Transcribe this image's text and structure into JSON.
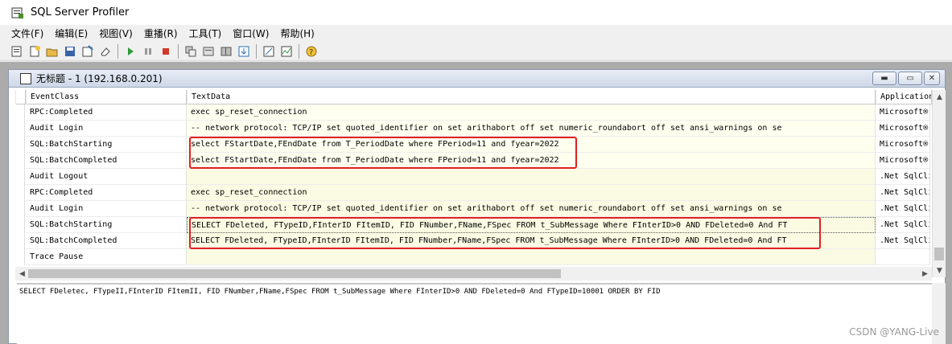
{
  "app": {
    "title": "SQL Server Profiler"
  },
  "menu": [
    "文件(F)",
    "编辑(E)",
    "视图(V)",
    "重播(R)",
    "工具(T)",
    "窗口(W)",
    "帮助(H)"
  ],
  "trace_window": {
    "title": "无标题 - 1 (192.168.0.201)",
    "columns": [
      "EventClass",
      "TextData",
      "Application"
    ],
    "rows": [
      {
        "event": "RPC:Completed",
        "text": "exec sp_reset_connection",
        "app": "Microsoft®"
      },
      {
        "event": "Audit Login",
        "text": "-- network protocol: TCP/IP  set quoted_identifier on  set arithabort off  set numeric_roundabort off  set ansi_warnings on  se",
        "app": "Microsoft®"
      },
      {
        "event": "SQL:BatchStarting",
        "text": "select FStartDate,FEndDate from T_PeriodDate where FPeriod=11 and fyear=2022",
        "app": "Microsoft®"
      },
      {
        "event": "SQL:BatchCompleted",
        "text": "select FStartDate,FEndDate from T_PeriodDate where FPeriod=11 and fyear=2022",
        "app": "Microsoft®"
      },
      {
        "event": "Audit Logout",
        "text": "",
        "app": ".Net SqlCli"
      },
      {
        "event": "RPC:Completed",
        "text": "exec sp_reset_connection",
        "app": ".Net SqlCli"
      },
      {
        "event": "Audit Login",
        "text": "-- network protocol: TCP/IP  set quoted_identifier on  set arithabort off  set numeric_roundabort off  set ansi_warnings on  se",
        "app": ".Net SqlCli"
      },
      {
        "event": "SQL:BatchStarting",
        "text": " SELECT  FDeleted,  FTypeID,FInterID FItemID,  FID FNumber,FName,FSpec FROM t_SubMessage Where FInterID>0  AND FDeleted=0  And FT",
        "app": ".Net SqlCli"
      },
      {
        "event": "SQL:BatchCompleted",
        "text": " SELECT  FDeleted,  FTypeID,FInterID FItemID,  FID FNumber,FName,FSpec FROM t_SubMessage Where FInterID>0  AND FDeleted=0  And FT",
        "app": ".Net SqlCli"
      },
      {
        "event": "Trace Pause",
        "text": "",
        "app": ""
      }
    ],
    "detail_text": "SELECT  FDeletec,  FTypeII,FInterID FItemII,  FID FNumber,FName,FSpec FROM t_SubMessage Where FInterID>0  AND FDeleted=0  And FTypeID=10001 ORDER BY FID"
  },
  "watermark": "CSDN @YANG-Live",
  "colors": {
    "highlight_box": "#e02020",
    "text_cell_bg": "#fffff0"
  }
}
